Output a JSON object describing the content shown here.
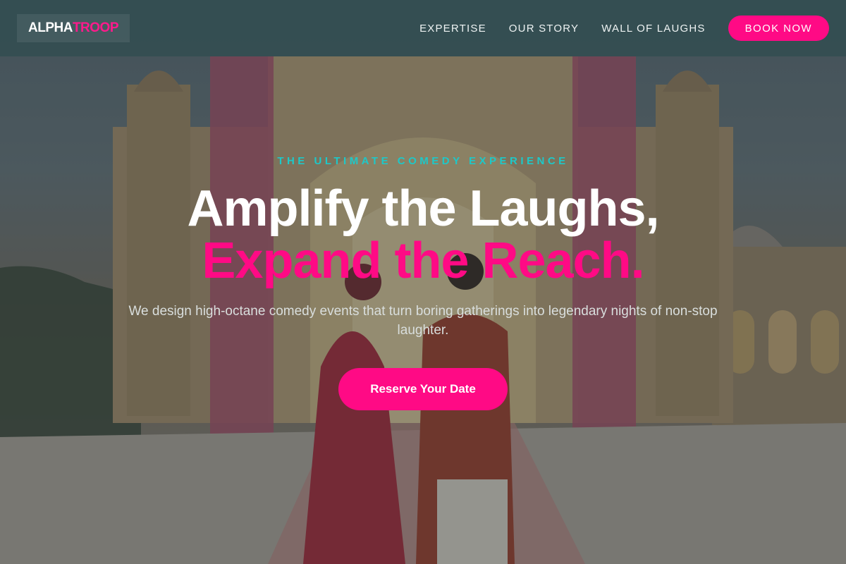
{
  "brand": {
    "name_part1": "ALPHA",
    "name_part2": "TROOP"
  },
  "nav": {
    "links": [
      {
        "label": "EXPERTISE"
      },
      {
        "label": "OUR STORY"
      },
      {
        "label": "WALL OF LAUGHS"
      }
    ],
    "cta_label": "BOOK NOW"
  },
  "hero": {
    "eyebrow": "THE ULTIMATE COMEDY EXPERIENCE",
    "headline_line1": "Amplify the Laughs,",
    "headline_line2": "Expand the Reach.",
    "subtext": "We design high-octane comedy events that turn boring gatherings into legendary nights of non-stop laughter.",
    "cta_label": "Reserve Your Date"
  },
  "colors": {
    "accent_pink": "#ff0a85",
    "accent_teal": "#1ec8c8",
    "nav_background": "#344e52",
    "text_white": "#ffffff"
  }
}
